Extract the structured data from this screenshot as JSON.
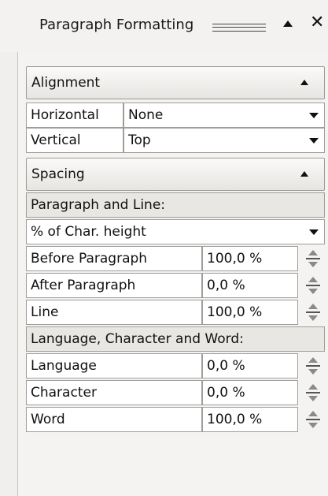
{
  "title": "Paragraph Formatting",
  "icons": {
    "grip": "grip-lines-icon",
    "collapse": "caret-up-icon",
    "close": "close-icon",
    "dropdown": "caret-down-icon",
    "spinner": "spinner-icon"
  },
  "alignment": {
    "header": "Alignment",
    "horizontal": {
      "label": "Horizontal",
      "value": "None"
    },
    "vertical": {
      "label": "Vertical",
      "value": "Top"
    }
  },
  "spacing": {
    "header": "Spacing",
    "paragraph_line_label": "Paragraph and Line:",
    "unit_value": "% of Char. height",
    "before": {
      "label": "Before Paragraph",
      "value": "100,0 %"
    },
    "after": {
      "label": "After Paragraph",
      "value": "0,0 %"
    },
    "line": {
      "label": "Line",
      "value": "100,0 %"
    },
    "lcw_label": "Language, Character and Word:",
    "language": {
      "label": "Language",
      "value": "0,0 %"
    },
    "character": {
      "label": "Character",
      "value": "0,0 %"
    },
    "word": {
      "label": "Word",
      "value": "100,0 %"
    }
  }
}
